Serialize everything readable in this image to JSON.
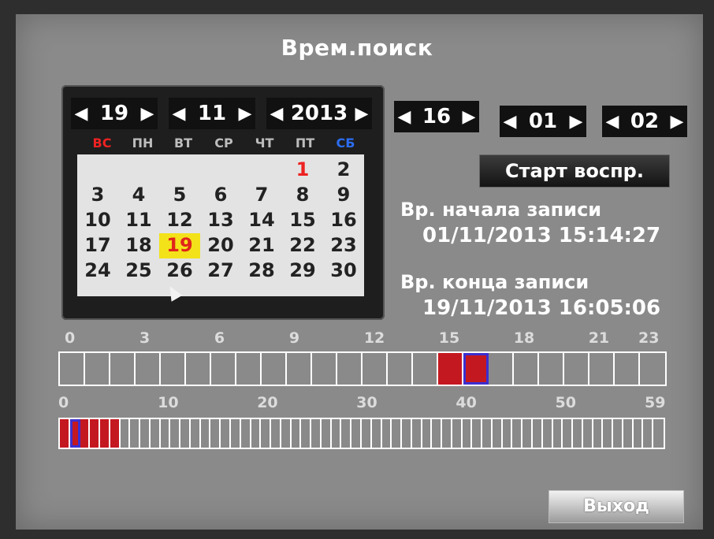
{
  "title": "Врем.поиск",
  "date": {
    "day": "19",
    "month": "11",
    "year": "2013"
  },
  "time": {
    "hour": "16",
    "minute": "01",
    "second": "02"
  },
  "weekdays": [
    "ВС",
    "ПН",
    "ВТ",
    "СР",
    "ЧТ",
    "ПТ",
    "СБ"
  ],
  "calendar": {
    "weeks": [
      [
        "",
        "",
        "",
        "",
        "",
        "1",
        "2"
      ],
      [
        "3",
        "4",
        "5",
        "6",
        "7",
        "8",
        "9"
      ],
      [
        "10",
        "11",
        "12",
        "13",
        "14",
        "15",
        "16"
      ],
      [
        "17",
        "18",
        "19",
        "20",
        "21",
        "22",
        "23"
      ],
      [
        "24",
        "25",
        "26",
        "27",
        "28",
        "29",
        "30"
      ]
    ],
    "selected_day": "19",
    "recorded_days": [
      "1"
    ]
  },
  "start_button": "Старт воспр.",
  "record_start_label": "Вр. начала записи",
  "record_start_value": "01/11/2013 15:14:27",
  "record_end_label": "Вр. конца записи",
  "record_end_value": "19/11/2013 16:05:06",
  "hour_scale": [
    "0",
    "3",
    "6",
    "9",
    "12",
    "15",
    "18",
    "21",
    "23"
  ],
  "hour_bar": {
    "cells": 24,
    "recorded": [
      15,
      16
    ],
    "current": 16
  },
  "minute_scale": [
    "0",
    "10",
    "20",
    "30",
    "40",
    "50",
    "59"
  ],
  "minute_bar": {
    "cells": 60,
    "recorded": [
      0,
      1,
      2,
      3,
      4,
      5
    ],
    "current": 1
  },
  "exit_button": "Выход",
  "colors": {
    "recorded": "#c41820",
    "current_outline": "#3b2fd0",
    "selected_day_bg": "#f3e21a",
    "sunday": "#e22",
    "saturday": "#2c6cf0"
  }
}
